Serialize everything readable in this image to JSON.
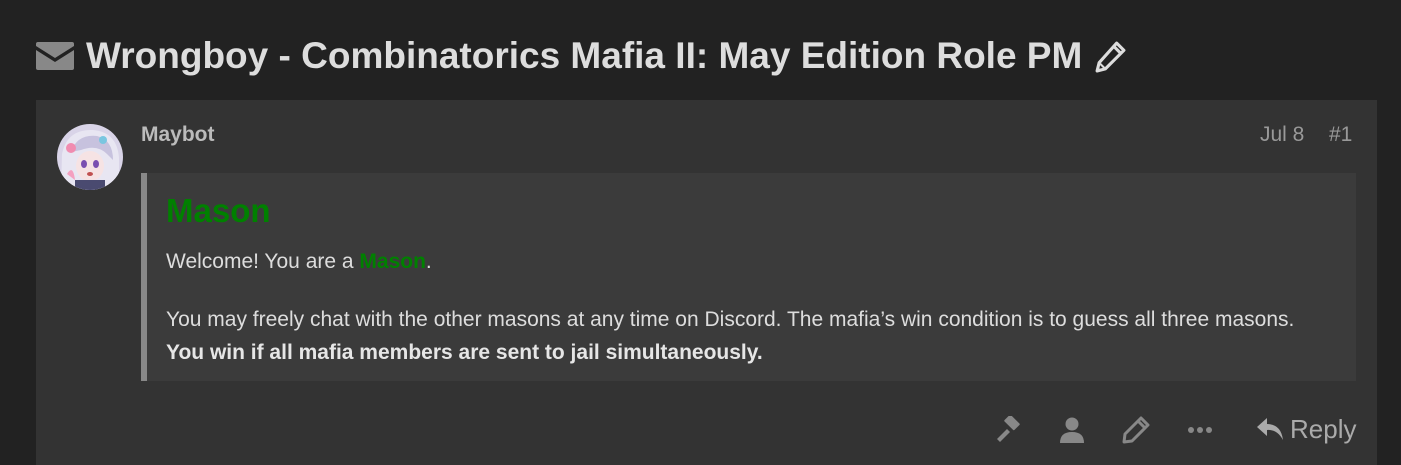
{
  "topic": {
    "title": "Wrongboy - Combinatorics Mafia II: May Edition Role PM",
    "icon": "envelope-icon",
    "edit_icon": "pencil-icon"
  },
  "post": {
    "username": "Maybot",
    "date": "Jul 8",
    "number": "#1",
    "avatar": "avatar-image",
    "quote": {
      "heading": "Mason",
      "welcome_prefix": "Welcome! You are a ",
      "welcome_role": "Mason",
      "welcome_suffix": ".",
      "body_text": "You may freely chat with the other masons at any time on Discord. The mafia’s win condition is to guess all three masons. ",
      "body_bold": "You win if all mafia members are sent to jail simultaneously."
    },
    "actions": {
      "icons": [
        "gavel-icon",
        "user-icon",
        "pencil-icon",
        "more-icon"
      ],
      "reply_label": "Reply"
    }
  },
  "colors": {
    "background": "#222222",
    "post_background": "#333333",
    "quote_background": "#3b3b3b",
    "role_green": "#008000",
    "text": "#dddddd",
    "muted": "#999999"
  }
}
